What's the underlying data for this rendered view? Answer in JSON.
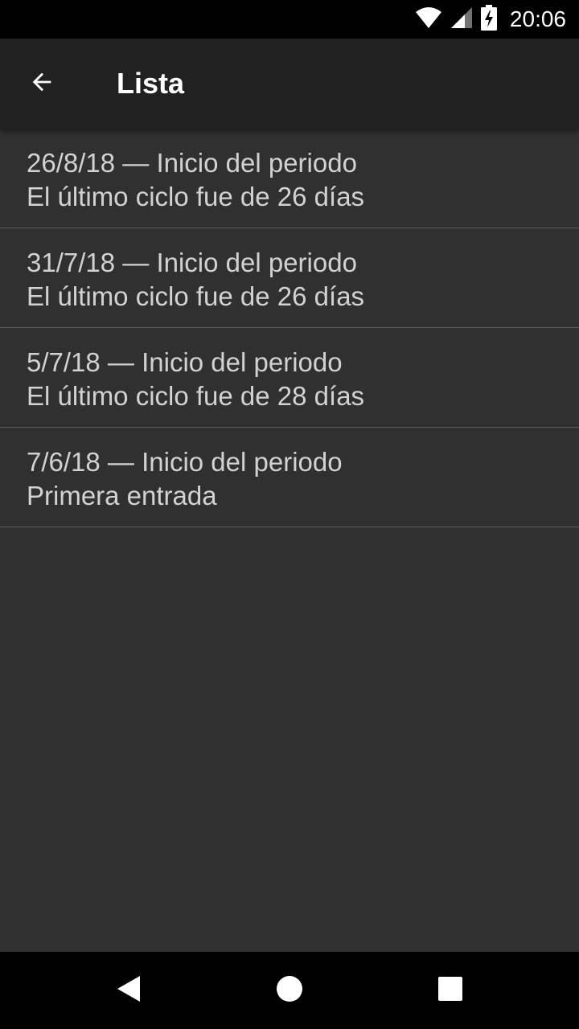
{
  "status_bar": {
    "time": "20:06",
    "icons": [
      "wifi-icon",
      "signal-icon",
      "battery-charging-icon"
    ]
  },
  "app_bar": {
    "title": "Lista",
    "back_icon": "arrow-back-icon"
  },
  "list": {
    "items": [
      {
        "line1": "26/8/18 — Inicio del periodo",
        "line2": "El último ciclo fue de 26 días"
      },
      {
        "line1": "31/7/18 — Inicio del periodo",
        "line2": "El último ciclo fue de 26 días"
      },
      {
        "line1": "5/7/18 — Inicio del periodo",
        "line2": "El último ciclo fue de 28 días"
      },
      {
        "line1": "7/6/18 — Inicio del periodo",
        "line2": "Primera entrada"
      }
    ]
  },
  "nav_bar": {
    "icons": [
      "nav-back-icon",
      "nav-home-icon",
      "nav-recents-icon"
    ]
  },
  "colors": {
    "background": "#303030",
    "app_bar": "#212121",
    "text": "#d2d2d2",
    "divider": "#5a5a5a"
  }
}
